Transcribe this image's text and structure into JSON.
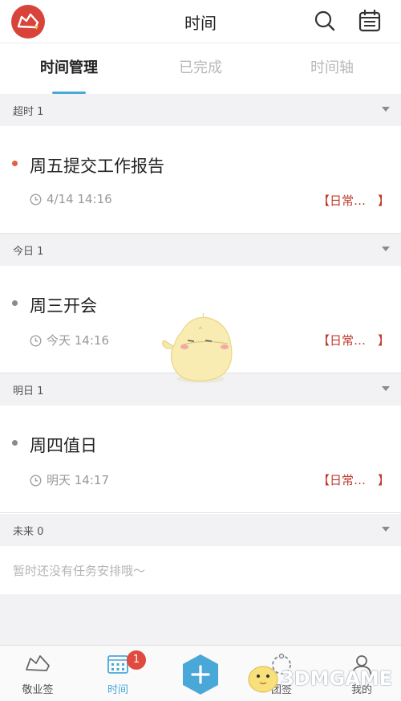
{
  "header": {
    "title": "时间"
  },
  "tabs": [
    {
      "label": "时间管理",
      "active": true
    },
    {
      "label": "已完成",
      "active": false
    },
    {
      "label": "时间轴",
      "active": false
    }
  ],
  "sections": {
    "overdue": {
      "label": "超时 1",
      "task": {
        "title": "周五提交工作报告",
        "time": "4/14 14:16",
        "tag": "【日常…　】",
        "dot_color": "#e0603f"
      }
    },
    "today": {
      "label": "今日 1",
      "task": {
        "title": "周三开会",
        "time": "今天 14:16",
        "tag": "【日常…　】",
        "dot_color": "#8a8a8a"
      }
    },
    "tomorrow": {
      "label": "明日 1",
      "task": {
        "title": "周四值日",
        "time": "明天 14:17",
        "tag": "【日常…　】",
        "dot_color": "#8a8a8a"
      }
    },
    "future": {
      "label": "未来 0",
      "empty_text": "暂时还没有任务安排哦～"
    }
  },
  "bottom_nav": {
    "items": [
      {
        "label": "敬业签",
        "icon": "sign-icon"
      },
      {
        "label": "时间",
        "icon": "calendar-grid-icon",
        "active": true,
        "badge": "1"
      },
      {
        "label": "",
        "icon": "add-icon"
      },
      {
        "label": "团签",
        "icon": "team-icon"
      },
      {
        "label": "我的",
        "icon": "user-icon"
      }
    ]
  },
  "watermark": {
    "text": "3DMGAME"
  },
  "colors": {
    "brand_red": "#d9443a",
    "accent_blue": "#4aa8d8",
    "tag_red": "#c0392b",
    "badge_red": "#e04a3f"
  }
}
